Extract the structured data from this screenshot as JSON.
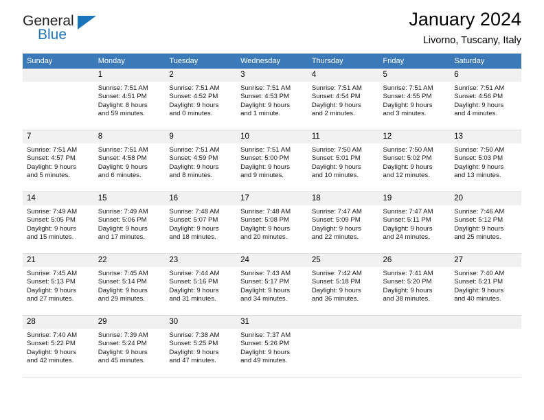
{
  "brand": {
    "name_part1": "General",
    "name_part2": "Blue",
    "accent_color": "#1b75bb"
  },
  "header": {
    "title": "January 2024",
    "subtitle": "Livorno, Tuscany, Italy"
  },
  "calendar": {
    "header_bg": "#3b79b8",
    "daynum_bg": "#f1f1f1",
    "weekday_headers": [
      "Sunday",
      "Monday",
      "Tuesday",
      "Wednesday",
      "Thursday",
      "Friday",
      "Saturday"
    ],
    "weeks": [
      [
        {
          "day": "",
          "lines": []
        },
        {
          "day": "1",
          "lines": [
            "Sunrise: 7:51 AM",
            "Sunset: 4:51 PM",
            "Daylight: 8 hours",
            "and 59 minutes."
          ]
        },
        {
          "day": "2",
          "lines": [
            "Sunrise: 7:51 AM",
            "Sunset: 4:52 PM",
            "Daylight: 9 hours",
            "and 0 minutes."
          ]
        },
        {
          "day": "3",
          "lines": [
            "Sunrise: 7:51 AM",
            "Sunset: 4:53 PM",
            "Daylight: 9 hours",
            "and 1 minute."
          ]
        },
        {
          "day": "4",
          "lines": [
            "Sunrise: 7:51 AM",
            "Sunset: 4:54 PM",
            "Daylight: 9 hours",
            "and 2 minutes."
          ]
        },
        {
          "day": "5",
          "lines": [
            "Sunrise: 7:51 AM",
            "Sunset: 4:55 PM",
            "Daylight: 9 hours",
            "and 3 minutes."
          ]
        },
        {
          "day": "6",
          "lines": [
            "Sunrise: 7:51 AM",
            "Sunset: 4:56 PM",
            "Daylight: 9 hours",
            "and 4 minutes."
          ]
        }
      ],
      [
        {
          "day": "7",
          "lines": [
            "Sunrise: 7:51 AM",
            "Sunset: 4:57 PM",
            "Daylight: 9 hours",
            "and 5 minutes."
          ]
        },
        {
          "day": "8",
          "lines": [
            "Sunrise: 7:51 AM",
            "Sunset: 4:58 PM",
            "Daylight: 9 hours",
            "and 6 minutes."
          ]
        },
        {
          "day": "9",
          "lines": [
            "Sunrise: 7:51 AM",
            "Sunset: 4:59 PM",
            "Daylight: 9 hours",
            "and 8 minutes."
          ]
        },
        {
          "day": "10",
          "lines": [
            "Sunrise: 7:51 AM",
            "Sunset: 5:00 PM",
            "Daylight: 9 hours",
            "and 9 minutes."
          ]
        },
        {
          "day": "11",
          "lines": [
            "Sunrise: 7:50 AM",
            "Sunset: 5:01 PM",
            "Daylight: 9 hours",
            "and 10 minutes."
          ]
        },
        {
          "day": "12",
          "lines": [
            "Sunrise: 7:50 AM",
            "Sunset: 5:02 PM",
            "Daylight: 9 hours",
            "and 12 minutes."
          ]
        },
        {
          "day": "13",
          "lines": [
            "Sunrise: 7:50 AM",
            "Sunset: 5:03 PM",
            "Daylight: 9 hours",
            "and 13 minutes."
          ]
        }
      ],
      [
        {
          "day": "14",
          "lines": [
            "Sunrise: 7:49 AM",
            "Sunset: 5:05 PM",
            "Daylight: 9 hours",
            "and 15 minutes."
          ]
        },
        {
          "day": "15",
          "lines": [
            "Sunrise: 7:49 AM",
            "Sunset: 5:06 PM",
            "Daylight: 9 hours",
            "and 17 minutes."
          ]
        },
        {
          "day": "16",
          "lines": [
            "Sunrise: 7:48 AM",
            "Sunset: 5:07 PM",
            "Daylight: 9 hours",
            "and 18 minutes."
          ]
        },
        {
          "day": "17",
          "lines": [
            "Sunrise: 7:48 AM",
            "Sunset: 5:08 PM",
            "Daylight: 9 hours",
            "and 20 minutes."
          ]
        },
        {
          "day": "18",
          "lines": [
            "Sunrise: 7:47 AM",
            "Sunset: 5:09 PM",
            "Daylight: 9 hours",
            "and 22 minutes."
          ]
        },
        {
          "day": "19",
          "lines": [
            "Sunrise: 7:47 AM",
            "Sunset: 5:11 PM",
            "Daylight: 9 hours",
            "and 24 minutes."
          ]
        },
        {
          "day": "20",
          "lines": [
            "Sunrise: 7:46 AM",
            "Sunset: 5:12 PM",
            "Daylight: 9 hours",
            "and 25 minutes."
          ]
        }
      ],
      [
        {
          "day": "21",
          "lines": [
            "Sunrise: 7:45 AM",
            "Sunset: 5:13 PM",
            "Daylight: 9 hours",
            "and 27 minutes."
          ]
        },
        {
          "day": "22",
          "lines": [
            "Sunrise: 7:45 AM",
            "Sunset: 5:14 PM",
            "Daylight: 9 hours",
            "and 29 minutes."
          ]
        },
        {
          "day": "23",
          "lines": [
            "Sunrise: 7:44 AM",
            "Sunset: 5:16 PM",
            "Daylight: 9 hours",
            "and 31 minutes."
          ]
        },
        {
          "day": "24",
          "lines": [
            "Sunrise: 7:43 AM",
            "Sunset: 5:17 PM",
            "Daylight: 9 hours",
            "and 34 minutes."
          ]
        },
        {
          "day": "25",
          "lines": [
            "Sunrise: 7:42 AM",
            "Sunset: 5:18 PM",
            "Daylight: 9 hours",
            "and 36 minutes."
          ]
        },
        {
          "day": "26",
          "lines": [
            "Sunrise: 7:41 AM",
            "Sunset: 5:20 PM",
            "Daylight: 9 hours",
            "and 38 minutes."
          ]
        },
        {
          "day": "27",
          "lines": [
            "Sunrise: 7:40 AM",
            "Sunset: 5:21 PM",
            "Daylight: 9 hours",
            "and 40 minutes."
          ]
        }
      ],
      [
        {
          "day": "28",
          "lines": [
            "Sunrise: 7:40 AM",
            "Sunset: 5:22 PM",
            "Daylight: 9 hours",
            "and 42 minutes."
          ]
        },
        {
          "day": "29",
          "lines": [
            "Sunrise: 7:39 AM",
            "Sunset: 5:24 PM",
            "Daylight: 9 hours",
            "and 45 minutes."
          ]
        },
        {
          "day": "30",
          "lines": [
            "Sunrise: 7:38 AM",
            "Sunset: 5:25 PM",
            "Daylight: 9 hours",
            "and 47 minutes."
          ]
        },
        {
          "day": "31",
          "lines": [
            "Sunrise: 7:37 AM",
            "Sunset: 5:26 PM",
            "Daylight: 9 hours",
            "and 49 minutes."
          ]
        },
        {
          "day": "",
          "lines": []
        },
        {
          "day": "",
          "lines": []
        },
        {
          "day": "",
          "lines": []
        }
      ]
    ]
  }
}
